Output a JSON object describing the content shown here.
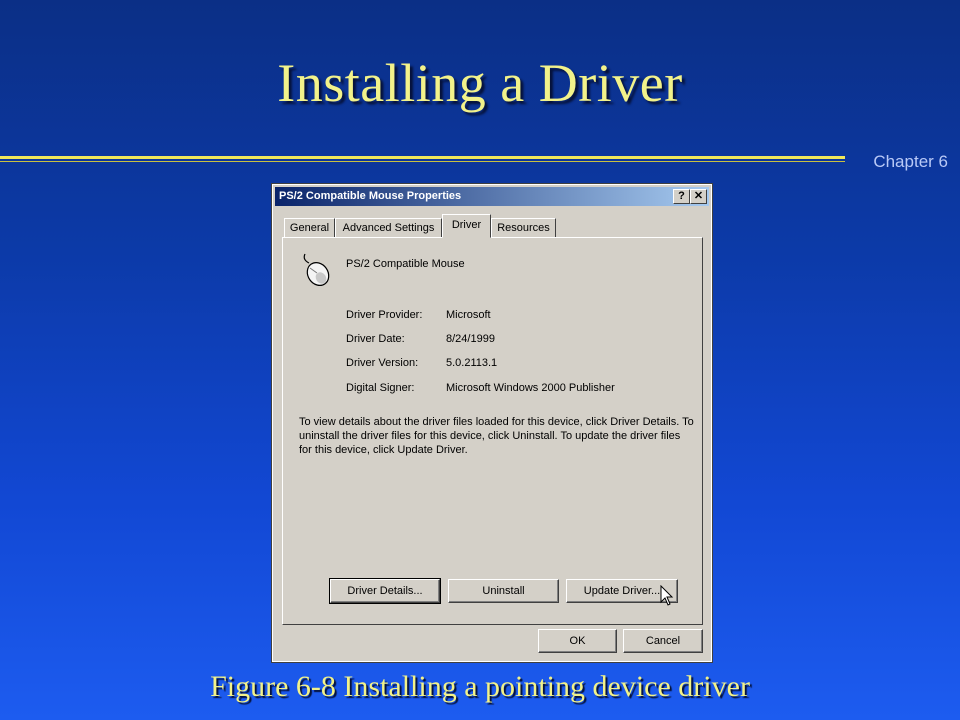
{
  "slide": {
    "title": "Installing a Driver",
    "chapter": "Chapter 6",
    "caption": "Figure 6-8  Installing a pointing device driver"
  },
  "dialog": {
    "title": "PS/2 Compatible Mouse Properties",
    "help_label": "?",
    "close_label": "✕",
    "tabs": [
      {
        "label": "General",
        "active": false
      },
      {
        "label": "Advanced Settings",
        "active": false
      },
      {
        "label": "Driver",
        "active": true
      },
      {
        "label": "Resources",
        "active": false
      }
    ],
    "device_name": "PS/2 Compatible Mouse",
    "device_icon": "mouse-icon",
    "fields": [
      {
        "label": "Driver Provider:",
        "value": "Microsoft"
      },
      {
        "label": "Driver Date:",
        "value": "8/24/1999"
      },
      {
        "label": "Driver Version:",
        "value": "5.0.2113.1"
      },
      {
        "label": "Digital Signer:",
        "value": "Microsoft Windows 2000 Publisher"
      }
    ],
    "description": "To view details about the driver files loaded for this device, click Driver Details. To uninstall the driver files for this device, click Uninstall. To update the driver files for this device, click Update Driver.",
    "buttons": {
      "driver_details": "Driver Details...",
      "uninstall": "Uninstall",
      "update_driver": "Update Driver...",
      "ok": "OK",
      "cancel": "Cancel"
    }
  },
  "colors": {
    "title_text": "#f2f28a",
    "accent_rule": "#f0e85a",
    "titlebar_start": "#0a246a",
    "titlebar_end": "#a6caf0",
    "dialog_face": "#d4d0c8"
  }
}
